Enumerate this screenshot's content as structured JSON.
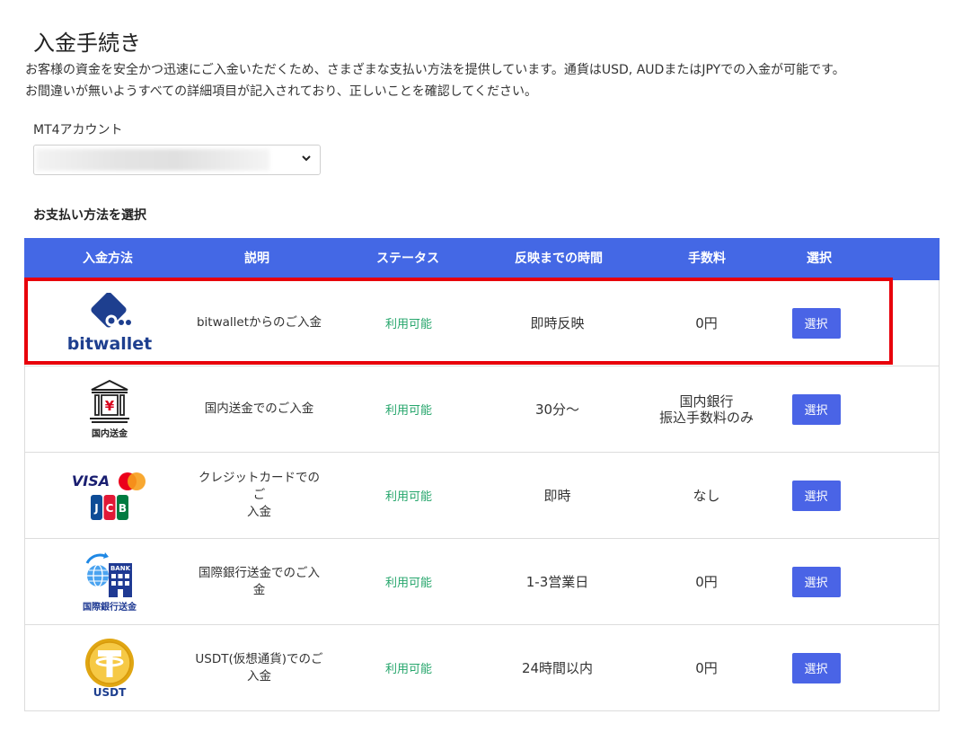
{
  "page": {
    "title": "入金手続き",
    "intro_line1": "お客様の資金を安全かつ迅速にご入金いただくため、さまざまな支払い方法を提供しています。通貨はUSD, AUDまたはJPYでの入金が可能です。",
    "intro_line2": "お間違いが無いようすべての詳細項目が記入されており、正しいことを確認してください。"
  },
  "account": {
    "label": "MT4アカウント",
    "selected_value": ""
  },
  "payment": {
    "heading": "お支払い方法を選択",
    "columns": [
      "入金方法",
      "説明",
      "ステータス",
      "反映までの時間",
      "手数料",
      "選択"
    ],
    "rows": [
      {
        "method_icon": "bitwallet-logo",
        "logo_text": "bitwallet",
        "description": "bitwalletからのご入金",
        "status": "利用可能",
        "time": "即時反映",
        "fee": "0円",
        "button": "選択"
      },
      {
        "method_icon": "bank-icon",
        "logo_text": "国内送金",
        "description": "国内送金でのご入金",
        "status": "利用可能",
        "time": "30分〜",
        "fee": "国内銀行\n振込手数料のみ",
        "fee_line1": "国内銀行",
        "fee_line2": "振込手数料のみ",
        "button": "選択"
      },
      {
        "method_icon": "credit-card-icons",
        "logo_text": "VISA",
        "description_line1": "クレジットカードでのご",
        "description_line2": "入金",
        "status": "利用可能",
        "time": "即時",
        "fee": "なし",
        "button": "選択"
      },
      {
        "method_icon": "international-bank-icon",
        "logo_text": "国際銀行送金",
        "bank_sign": "BANK",
        "description": "国際銀行送金でのご入金",
        "status": "利用可能",
        "time": "1-3営業日",
        "fee": "0円",
        "button": "選択"
      },
      {
        "method_icon": "usdt-coin-icon",
        "logo_text": "USDT",
        "description_line1": "USDT(仮想通貨)でのご",
        "description_line2": "入金",
        "status": "利用可能",
        "time": "24時間以内",
        "fee": "0円",
        "button": "選択"
      }
    ]
  },
  "colors": {
    "header_bg": "#4468e5",
    "button_bg": "#4a64e6",
    "status_green": "#26a66c",
    "highlight_red": "#e8000b",
    "bitwallet_navy": "#1e3f8f"
  }
}
